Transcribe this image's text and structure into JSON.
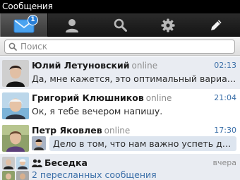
{
  "statusbar": {
    "title": "Сообщения"
  },
  "tabs": [
    {
      "icon": "mail-icon",
      "badge": "1"
    },
    {
      "icon": "contacts-icon"
    },
    {
      "icon": "search-icon"
    },
    {
      "icon": "settings-icon"
    },
    {
      "icon": "compose-icon"
    }
  ],
  "search": {
    "placeholder": "Поиск"
  },
  "conversations": [
    {
      "name": "Юлий Летуновский",
      "status": "online",
      "time": "02:13",
      "preview": "Да, мне кажется, это оптимальный вариант. При..."
    },
    {
      "name": "Григорий Клюшников",
      "status": "online",
      "time": "21:04",
      "preview": "Ок, я тебе вечером напишу."
    },
    {
      "name": "Петр Яковлев",
      "status": "online",
      "time": "17:30",
      "preview": "Дело в том, что нам важно успеть до след..."
    },
    {
      "name": "Беседка",
      "time": "вчера",
      "preview": "2 пересланных сообщения"
    }
  ],
  "colors": {
    "accent": "#2a7fd6",
    "link": "#3b6fa8",
    "unread_bg": "#e9ecf2"
  }
}
